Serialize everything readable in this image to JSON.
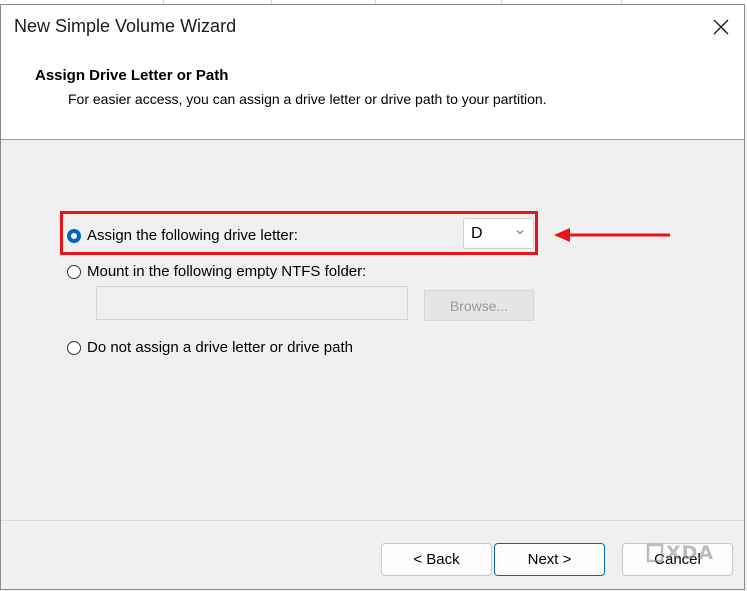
{
  "window": {
    "title": "New Simple Volume Wizard"
  },
  "header": {
    "title": "Assign Drive Letter or Path",
    "subtitle": "For easier access, you can assign a drive letter or drive path to your partition."
  },
  "options": {
    "assign_letter": {
      "label": "Assign the following drive letter:",
      "selected": true
    },
    "drive_letter": {
      "value": "D"
    },
    "mount_folder": {
      "label": "Mount in the following empty NTFS folder:",
      "selected": false,
      "value": ""
    },
    "browse": {
      "label": "Browse..."
    },
    "no_assign": {
      "label": "Do not assign a drive letter or drive path",
      "selected": false
    }
  },
  "buttons": {
    "back": "< Back",
    "next": "Next >",
    "cancel": "Cancel"
  },
  "watermark": "XDA",
  "colors": {
    "highlight": "#e8141c",
    "accent": "#0067c0"
  }
}
